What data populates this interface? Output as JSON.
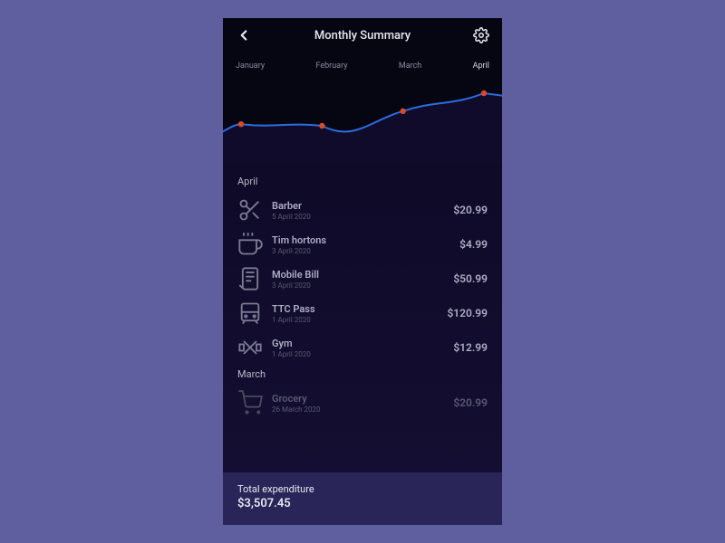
{
  "header": {
    "title": "Monthly Summary"
  },
  "months": [
    "January",
    "February",
    "March",
    "April"
  ],
  "chart_data": {
    "type": "line",
    "categories": [
      "January",
      "February",
      "March",
      "April"
    ],
    "values": [
      42,
      40,
      58,
      80
    ],
    "title": "",
    "xlabel": "",
    "ylabel": "",
    "ylim": [
      0,
      100
    ],
    "accentColor": "#2b6de0",
    "pointColor": "#d84a2a"
  },
  "sections": [
    {
      "label": "April",
      "items": [
        {
          "icon": "scissors",
          "name": "Barber",
          "date": "5 April 2020",
          "amount": "$20.99"
        },
        {
          "icon": "coffee",
          "name": "Tim hortons",
          "date": "3 April 2020",
          "amount": "$4.99"
        },
        {
          "icon": "phone-bill",
          "name": "Mobile Bill",
          "date": "3 April 2020",
          "amount": "$50.99"
        },
        {
          "icon": "transit",
          "name": "TTC Pass",
          "date": "1 April 2020",
          "amount": "$120.99"
        },
        {
          "icon": "gym",
          "name": "Gym",
          "date": "1 April 2020",
          "amount": "$12.99"
        }
      ]
    },
    {
      "label": "March",
      "items": [
        {
          "icon": "grocery",
          "name": "Grocery",
          "date": "26 March 2020",
          "amount": "$20.99",
          "faded": true
        }
      ]
    }
  ],
  "footer": {
    "label": "Total expenditure",
    "total": "$3,507.45"
  }
}
